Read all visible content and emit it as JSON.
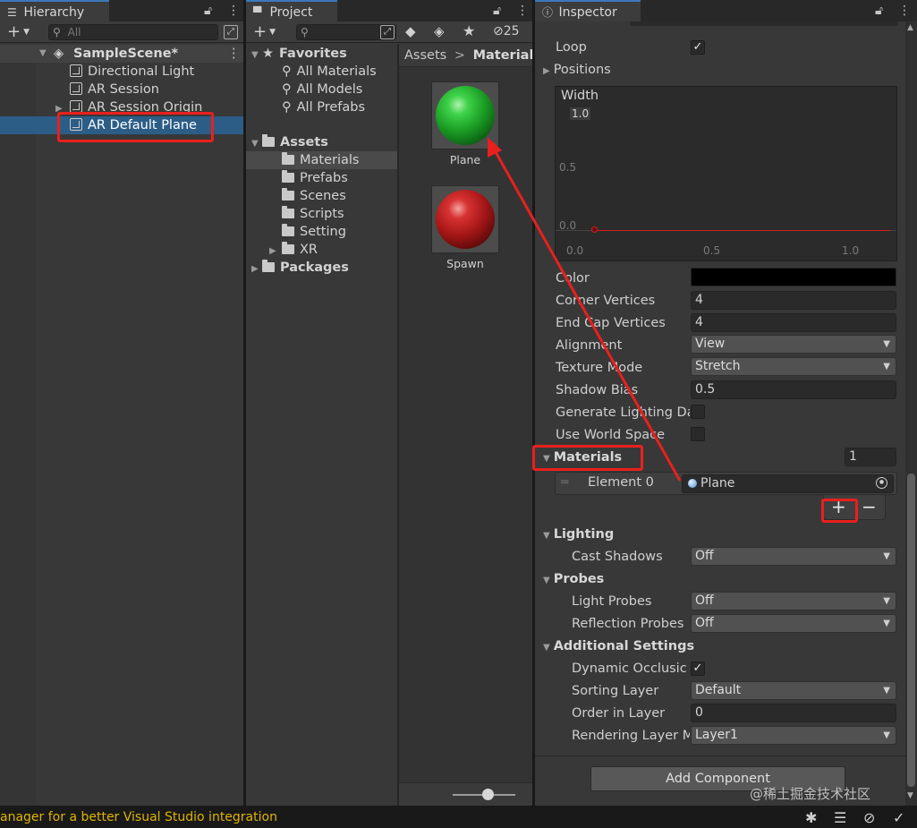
{
  "hierarchy": {
    "tab_label": "Hierarchy",
    "search_placeholder": "All",
    "scene_name": "SampleScene*",
    "items": [
      {
        "label": "Directional Light"
      },
      {
        "label": "AR Session"
      },
      {
        "label": "AR Session Origin"
      },
      {
        "label": "AR Default Plane"
      }
    ]
  },
  "project": {
    "tab_label": "Project",
    "hidden_count": "25",
    "favorites_label": "Favorites",
    "favorites": [
      "All Materials",
      "All Models",
      "All Prefabs"
    ],
    "assets_label": "Assets",
    "folders": [
      "Materials",
      "Prefabs",
      "Scenes",
      "Scripts",
      "Setting",
      "XR"
    ],
    "packages_label": "Packages",
    "breadcrumb": {
      "root": "Assets",
      "sep": ">",
      "current": "Materials"
    },
    "materials": [
      {
        "name": "Plane",
        "color": "#1fae2b"
      },
      {
        "name": "Spawn",
        "color": "#c21e1e"
      }
    ]
  },
  "inspector": {
    "tab_label": "Inspector",
    "loop_label": "Loop",
    "positions_label": "Positions",
    "width_curve": {
      "title": "Width",
      "y_ticks": [
        "1.0",
        "0.5",
        "0.0"
      ],
      "x_ticks": [
        "0.0",
        "0.5",
        "1.0"
      ],
      "curve_color": "#d11f1f"
    },
    "props": [
      {
        "label": "Color",
        "type": "color",
        "value": "#000000"
      },
      {
        "label": "Corner Vertices",
        "type": "field",
        "value": "4"
      },
      {
        "label": "End Cap Vertices",
        "type": "field",
        "value": "4"
      },
      {
        "label": "Alignment",
        "type": "dropdown",
        "value": "View"
      },
      {
        "label": "Texture Mode",
        "type": "dropdown",
        "value": "Stretch"
      },
      {
        "label": "Shadow Bias",
        "type": "field",
        "value": "0.5"
      },
      {
        "label": "Generate Lighting Da",
        "type": "check",
        "value": ""
      },
      {
        "label": "Use World Space",
        "type": "check",
        "value": ""
      }
    ],
    "materials": {
      "label": "Materials",
      "count": "1",
      "element_label": "Element 0",
      "element_value": "Plane",
      "add_glyph": "+",
      "remove_glyph": "−"
    },
    "lighting": {
      "label": "Lighting",
      "cast_shadows_label": "Cast Shadows",
      "cast_shadows_value": "Off"
    },
    "probes": {
      "label": "Probes",
      "light_probes_label": "Light Probes",
      "light_probes_value": "Off",
      "reflection_probes_label": "Reflection Probes",
      "reflection_probes_value": "Off"
    },
    "additional": {
      "label": "Additional Settings",
      "dynamic_occlusion_label": "Dynamic Occlusic",
      "sorting_layer_label": "Sorting Layer",
      "sorting_layer_value": "Default",
      "order_in_layer_label": "Order in Layer",
      "order_in_layer_value": "0",
      "rendering_layer_label": "Rendering Layer M",
      "rendering_layer_value": "Layer1"
    },
    "add_component_label": "Add Component"
  },
  "status_bar": {
    "message": "anager for a better Visual Studio integration",
    "message_color": "#e0b400"
  },
  "watermark": "@稀土掘金技术社区",
  "accent": {
    "selection": "#2c5d87",
    "highlight": "#e8201e"
  }
}
